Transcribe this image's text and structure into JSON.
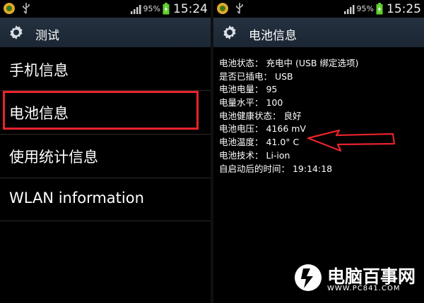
{
  "colors": {
    "accent": "#e8232b",
    "titlebar": "#1b2633",
    "battery": "#5fd02e"
  },
  "left": {
    "status": {
      "battery_pct": "95%",
      "time": "15:24"
    },
    "title": "测试",
    "menu": [
      {
        "label": "手机信息"
      },
      {
        "label": "电池信息"
      },
      {
        "label": "使用统计信息"
      },
      {
        "label": "WLAN information"
      }
    ]
  },
  "right": {
    "status": {
      "battery_pct": "95%",
      "time": "15:25"
    },
    "title": "电池信息",
    "lines": [
      "电池状态： 充电中 (USB 绑定选项)",
      "是否已插电： USB",
      "电池电量： 95",
      "电量水平： 100",
      "电池健康状态： 良好",
      "电池电压： 4166 mV",
      "电池温度： 41.0° C",
      "电池技术： Li-ion",
      "自启动后的时间： 19:14:18"
    ]
  },
  "watermark": {
    "text": "电脑百事网",
    "url": "WWW.PC841.COM"
  },
  "icons": {
    "settings": "gear-icon",
    "signal": "signal-icon",
    "usb": "usb-icon",
    "battery": "battery-charging-icon"
  }
}
